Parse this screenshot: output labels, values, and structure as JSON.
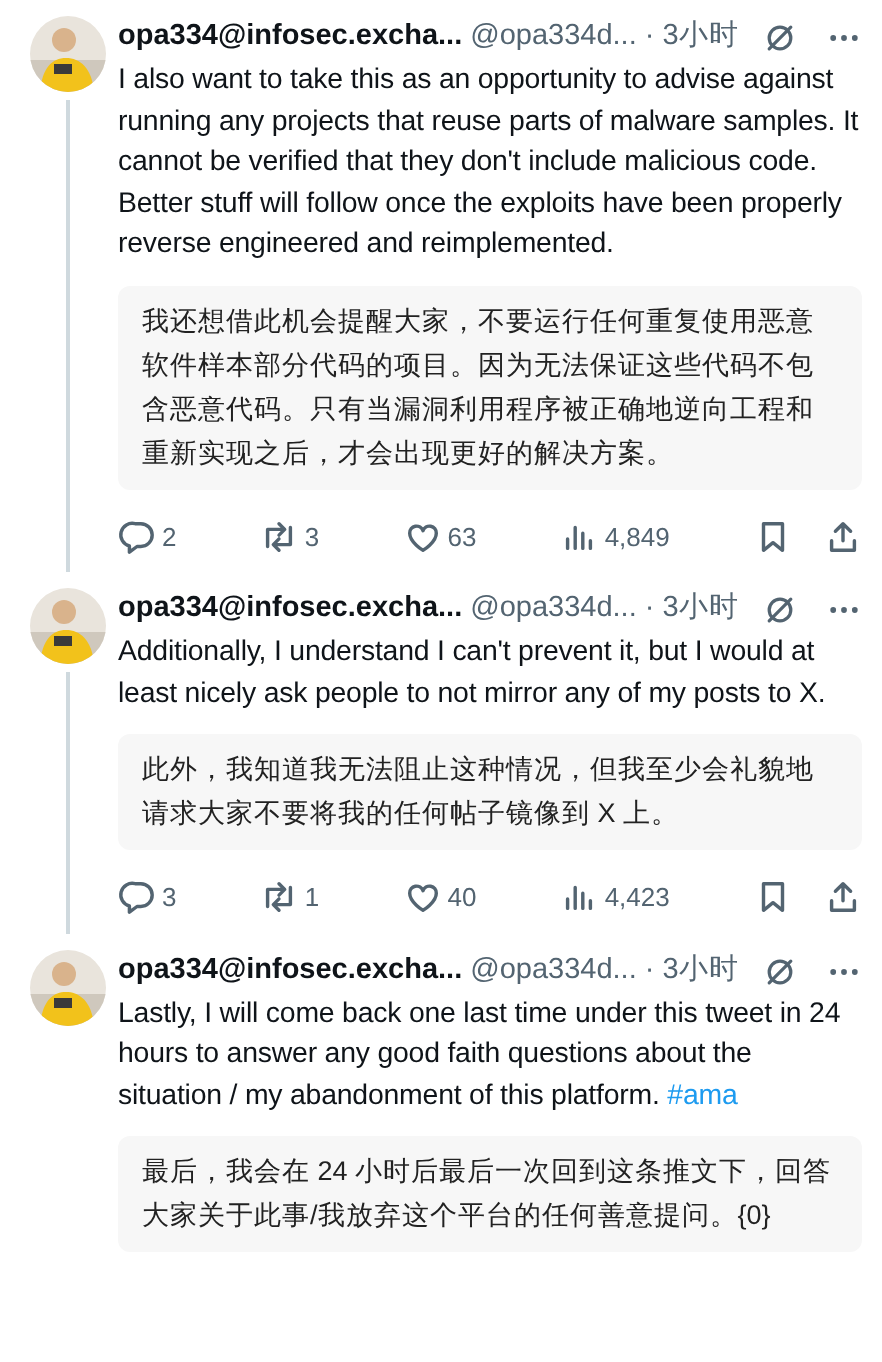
{
  "posts": [
    {
      "name": "opa334@infosec.excha...",
      "handle": "@opa334d...",
      "separator": "·",
      "time": "3小时",
      "text": "I also want to take this as an opportunity to advise against running any projects that reuse parts of malware samples. It cannot be verified that they don't include malicious code. Better stuff will follow once the exploits have been properly reverse engineered and reimplemented.",
      "translation": "我还想借此机会提醒大家，不要运行任何重复使用恶意软件样本部分代码的项目。因为无法保证这些代码不包含恶意代码。只有当漏洞利用程序被正确地逆向工程和重新实现之后，才会出现更好的解决方案。",
      "stats": {
        "replies": "2",
        "reposts": "3",
        "likes": "63",
        "views": "4,849"
      }
    },
    {
      "name": "opa334@infosec.excha...",
      "handle": "@opa334d...",
      "separator": "·",
      "time": "3小时",
      "text": "Additionally, I understand I can't prevent it, but I would at least nicely ask people to not mirror any of my posts to X.",
      "translation": "此外，我知道我无法阻止这种情况，但我至少会礼貌地请求大家不要将我的任何帖子镜像到 X 上。",
      "stats": {
        "replies": "3",
        "reposts": "1",
        "likes": "40",
        "views": "4,423"
      }
    },
    {
      "name": "opa334@infosec.excha...",
      "handle": "@opa334d...",
      "separator": "·",
      "time": "3小时",
      "text": "Lastly, I will come back one last time under this tweet in 24 hours to answer any good faith questions about the situation / my abandonment of this platform.",
      "hashtag": "#ama",
      "translation": "最后，我会在 24 小时后最后一次回到这条推文下，回答大家关于此事/我放弃这个平台的任何善意提问。{0}"
    }
  ]
}
